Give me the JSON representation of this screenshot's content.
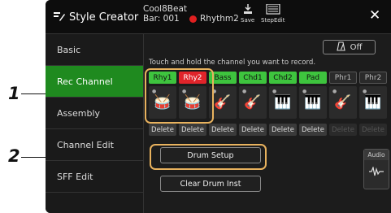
{
  "app": {
    "title": "Style Creator",
    "icon": "style-creator-icon"
  },
  "song": {
    "name": "Cool8Beat",
    "bar": "Bar: 001"
  },
  "record": {
    "channel": "Rhythm2"
  },
  "toolbar": {
    "save_label": "Save",
    "stepedit_label": "StepEdit"
  },
  "sidebar": {
    "items": [
      {
        "label": "Basic"
      },
      {
        "label": "Rec Channel"
      },
      {
        "label": "Assembly"
      },
      {
        "label": "Channel Edit"
      },
      {
        "label": "SFF Edit"
      }
    ]
  },
  "metronome": {
    "label": "Off"
  },
  "hint": "Touch and hold the channel you want to record.",
  "channels": [
    {
      "name": "Rhy1",
      "state": "green",
      "icon": "drum-kit-icon",
      "delete": "Delete"
    },
    {
      "name": "Rhy2",
      "state": "red",
      "icon": "drum-kit-icon",
      "delete": "Delete"
    },
    {
      "name": "Bass",
      "state": "green",
      "icon": "bass-guitar-icon",
      "delete": "Delete"
    },
    {
      "name": "Chd1",
      "state": "green",
      "icon": "electric-guitar-icon",
      "delete": "Delete"
    },
    {
      "name": "Chd2",
      "state": "green",
      "icon": "keyboard-icon",
      "delete": "Delete"
    },
    {
      "name": "Pad",
      "state": "green",
      "icon": "organ-icon",
      "delete": "Delete"
    },
    {
      "name": "Phr1",
      "state": "dim",
      "icon": "acoustic-guitar-icon",
      "delete": "Delete"
    },
    {
      "name": "Phr2",
      "state": "dim",
      "icon": "grand-piano-icon",
      "delete": "Delete"
    }
  ],
  "buttons": {
    "drum_setup": "Drum Setup",
    "clear_drum_inst": "Clear Drum Inst"
  },
  "audio": {
    "label": "Audio"
  },
  "callouts": [
    "1",
    "2"
  ],
  "colors": {
    "active_green": "#1f8a1f",
    "channel_green": "#3ec43e",
    "record_red": "#e0242a",
    "highlight": "#e8b25e"
  }
}
